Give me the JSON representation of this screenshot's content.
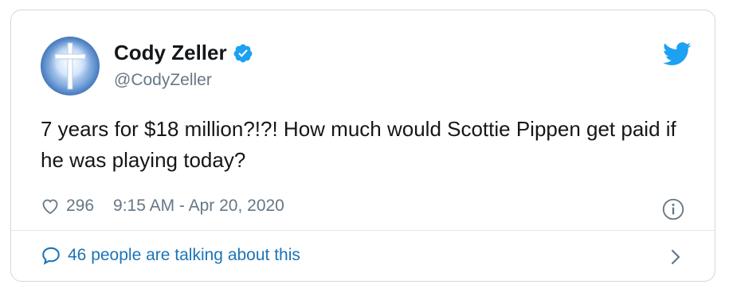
{
  "author": {
    "name": "Cody Zeller",
    "handle": "@CodyZeller"
  },
  "tweet": {
    "text": "7 years for $18 million?!?! How much would Scottie Pippen get paid if he was playing today?",
    "likes": "296",
    "timestamp": "9:15 AM - Apr 20, 2020"
  },
  "footer": {
    "conversation_label": "46 people are talking about this"
  },
  "colors": {
    "accent": "#1da1f2",
    "link": "#1b74b8",
    "muted": "#657786",
    "text": "#14171a",
    "border": "#cfd9de"
  },
  "icons": [
    "cross-avatar",
    "verified-badge-icon",
    "twitter-bird-icon",
    "heart-icon",
    "info-icon",
    "speech-bubble-icon",
    "chevron-right-icon"
  ]
}
